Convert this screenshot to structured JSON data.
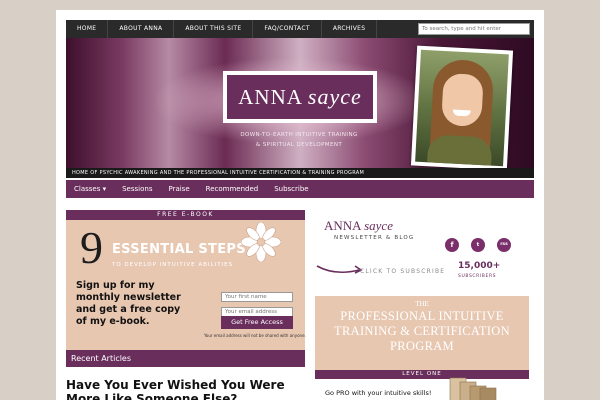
{
  "topnav": {
    "items": [
      "Home",
      "About Anna",
      "About This Site",
      "FAQ/Contact",
      "Archives"
    ],
    "search_placeholder": "To search, type and hit enter"
  },
  "banner": {
    "logo_name": "ANNA",
    "logo_script": "sayce",
    "tagline_line1": "Down-to-Earth Intuitive Training",
    "tagline_line2": "& Spiritual Development",
    "strip": "Home of Psychic Awakening and the Professional Intuitive Certification & Training Program"
  },
  "subnav": {
    "items": [
      "Classes ▾",
      "Sessions",
      "Praise",
      "Recommended",
      "Subscribe"
    ]
  },
  "ebook": {
    "header": "Free E-Book",
    "number": "9",
    "title": "ESSENTIAL STEPS",
    "subtitle": "to Develop Intuitive Abilities",
    "signup_text": "Sign up for my monthly newsletter and get a free copy of my e-book.",
    "first_name_placeholder": "Your first name",
    "email_placeholder": "Your email address",
    "button": "Get Free Access",
    "privacy": "Your email address will not be shared with anyone."
  },
  "recent": {
    "header": "Recent Articles",
    "article_title": "Have You Ever Wished You Were More Like Someone Else?"
  },
  "newsletter": {
    "logo_name": "ANNA",
    "logo_script": "sayce",
    "sub": "Newsletter & Blog",
    "social": [
      "f",
      "t",
      "rss"
    ],
    "click": "Click to Subscribe",
    "count": "15,000+",
    "count_label": "Subscribers"
  },
  "program": {
    "the": "THE",
    "title": "Professional Intuitive Training & Certification Program",
    "level": "Level One",
    "text": "Go PRO with your intuitive skills! Learn to do readings to practitioner"
  },
  "colors": {
    "accent": "#6a2e5c",
    "tan": "#e8c7b1",
    "nav": "#2a2a2a"
  }
}
